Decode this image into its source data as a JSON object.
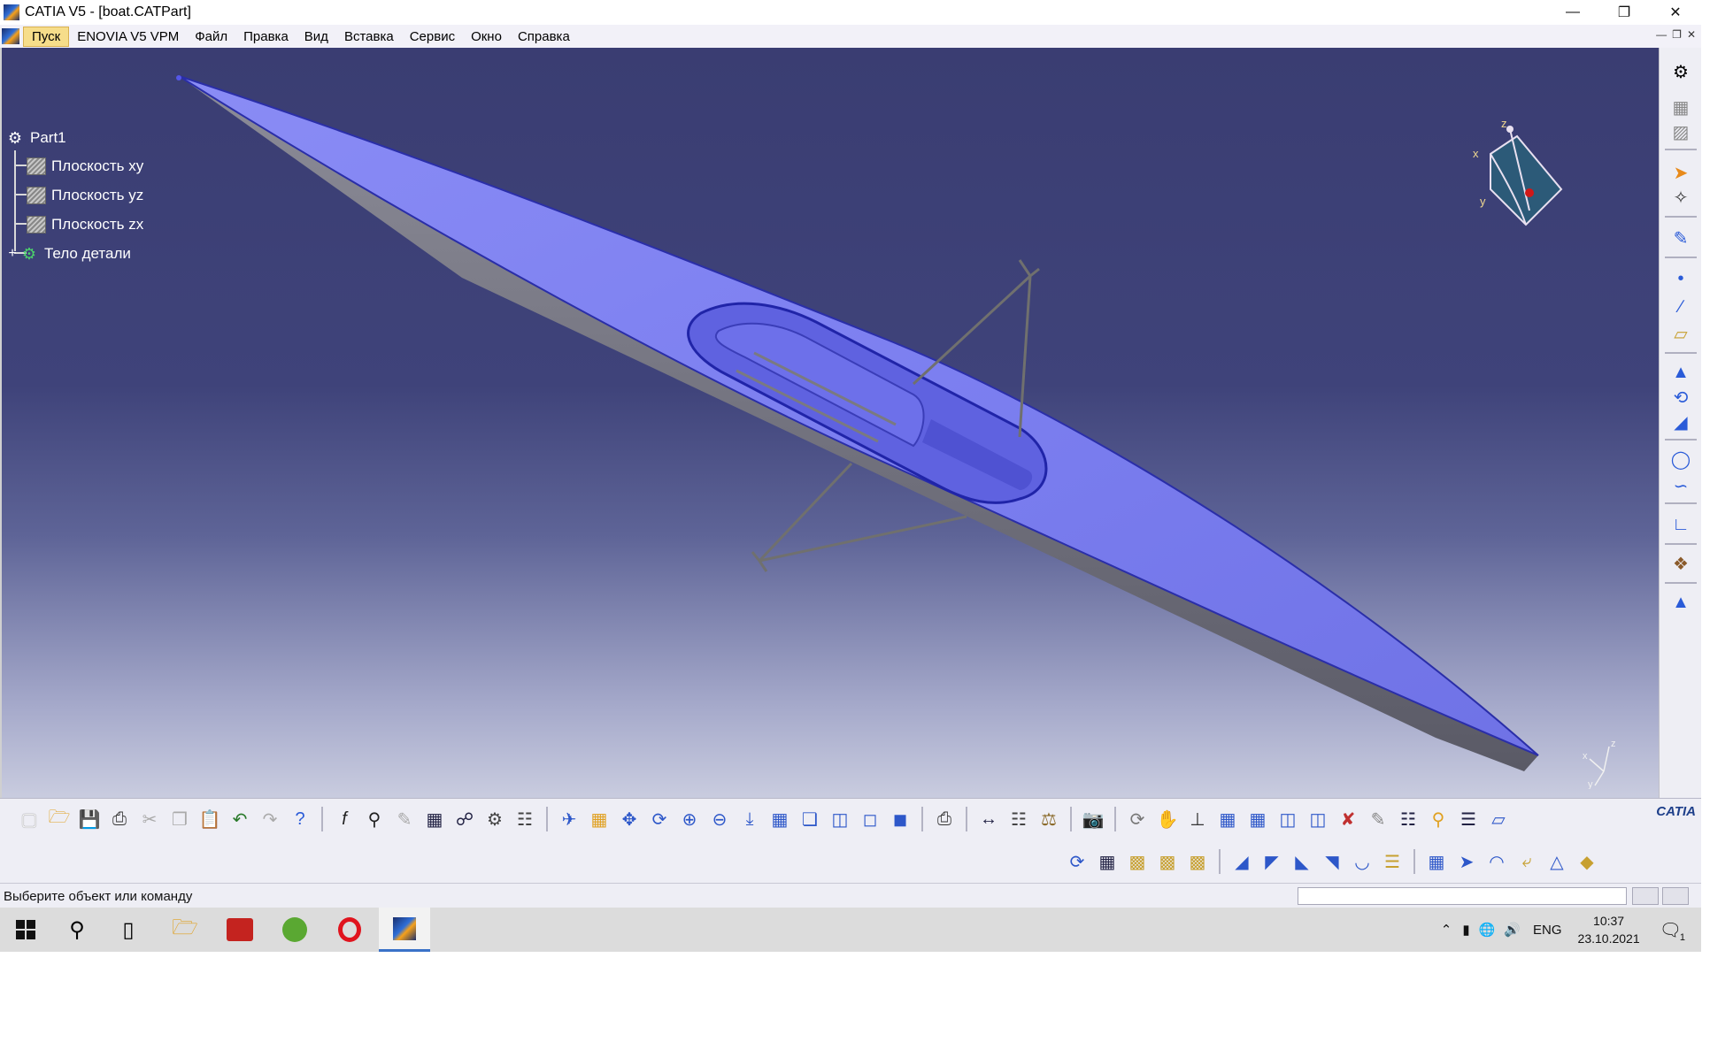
{
  "window": {
    "title": "CATIA V5 - [boat.CATPart]"
  },
  "menu": [
    "Пуск",
    "ENOVIA V5 VPM",
    "Файл",
    "Правка",
    "Вид",
    "Вставка",
    "Сервис",
    "Окно",
    "Справка"
  ],
  "tree": {
    "root": "Part1",
    "items": [
      "Плоскость xy",
      "Плоскость yz",
      "Плоскость zx",
      "Тело детали"
    ]
  },
  "compass": {
    "x": "x",
    "y": "y",
    "z": "z"
  },
  "axis_triad": {
    "x": "x",
    "y": "y",
    "z": "z"
  },
  "toolbar_brand": "CATIA",
  "status": {
    "message": "Выберите объект или команду",
    "command_input": ""
  },
  "taskbar": {
    "lang": "ENG",
    "time": "10:37",
    "date": "23.10.2021",
    "notifications": "1"
  }
}
